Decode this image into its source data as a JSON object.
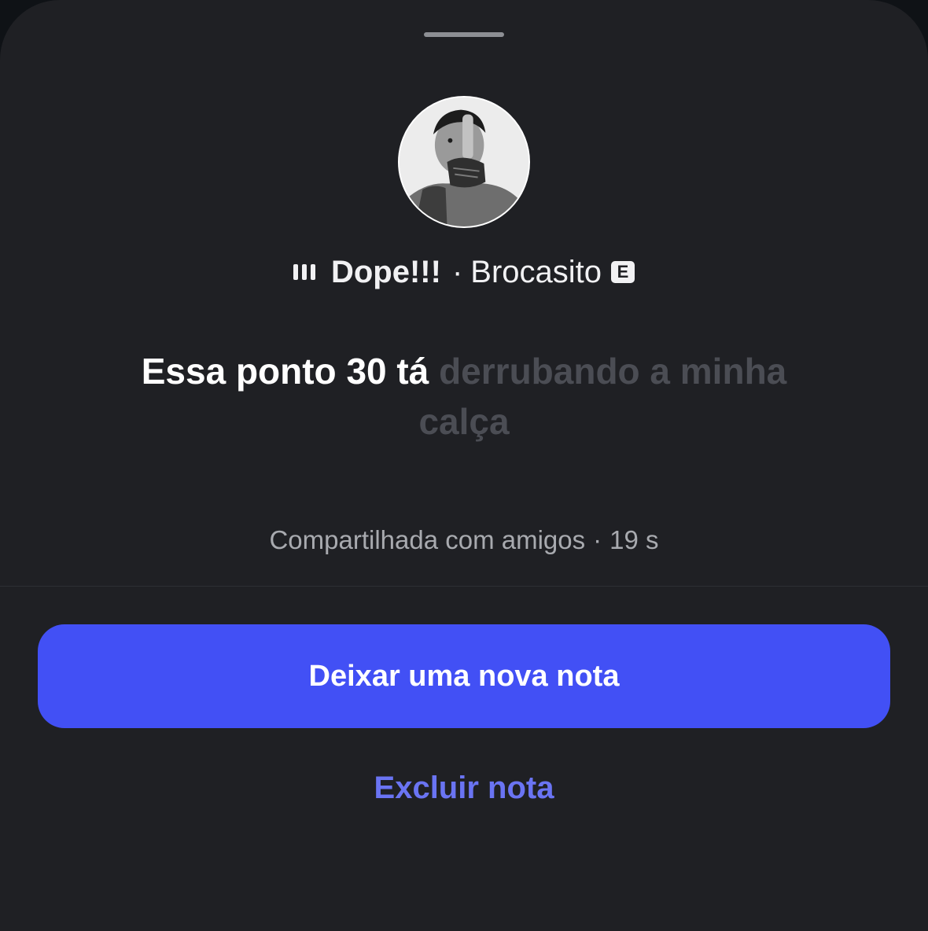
{
  "music": {
    "song": "Dope!!!",
    "separator": "·",
    "artist": "Brocasito",
    "explicit_badge": "E"
  },
  "note": {
    "lyric_active": "Essa ponto 30 tá ",
    "lyric_upcoming": "derrubando a minha calça"
  },
  "meta": {
    "shared_with": "Compartilhada com amigos",
    "separator": "·",
    "time_ago": "19 s"
  },
  "actions": {
    "primary_label": "Deixar uma nova nota",
    "delete_label": "Excluir nota"
  },
  "colors": {
    "sheet_background": "#1f2024",
    "primary_button": "#4250f5",
    "link": "#6a74f3",
    "upcoming_lyric": "#4b4d54",
    "muted_text": "#a8aaaf"
  },
  "icons": {
    "music_playing": "equalizer-bars-icon",
    "explicit": "explicit-badge-icon"
  }
}
